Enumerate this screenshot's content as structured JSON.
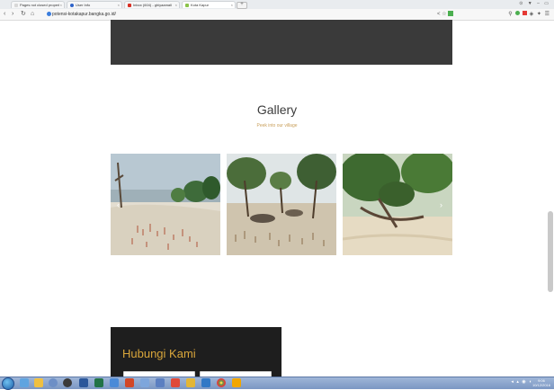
{
  "browser": {
    "tabs": [
      {
        "label": "Pages not closed properl",
        "favicon_color": "#d8d8d8",
        "active": false
      },
      {
        "label": "User Info",
        "favicon_color": "#2e63c8",
        "active": false
      },
      {
        "label": "Inbox (604) - ghiyaamall",
        "favicon_color": "#d93025",
        "active": false
      },
      {
        "label": "Kota Kapur",
        "favicon_color": "#8bc34a",
        "active": true
      }
    ],
    "url": "potensi-kotakapur.bangka.go.id/",
    "window_controls": "⊙ ▼ – ▭"
  },
  "page": {
    "gallery_title": "Gallery",
    "gallery_subtitle": "Peek into our village",
    "prev_arrow": "‹",
    "next_arrow": "›",
    "contact_title": "Hubungi Kami"
  },
  "taskbar": {
    "clock_time": "9:06",
    "clock_date": "10/12/2016"
  },
  "colors": {
    "accent_gold": "#c9a05c",
    "dark_section": "#1e1e1e",
    "banner": "#3a3a3a"
  }
}
